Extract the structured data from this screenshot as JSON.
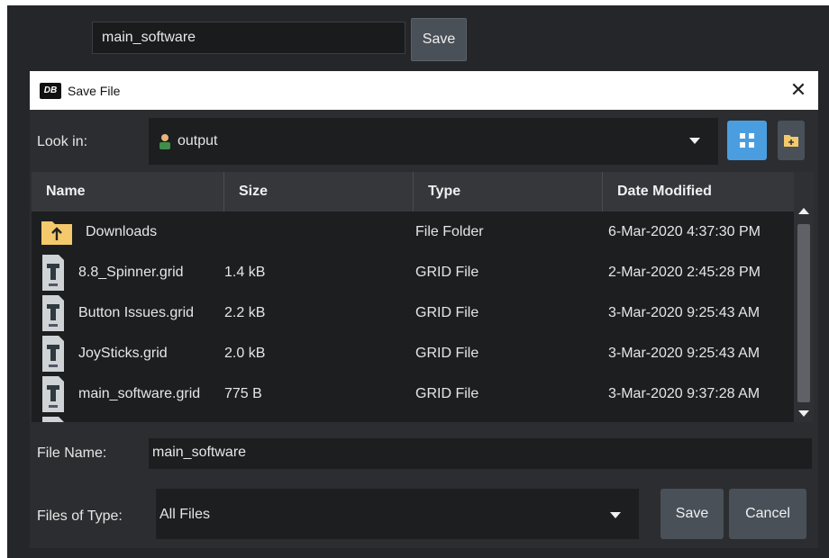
{
  "top_bar": {
    "name_value": "main_software",
    "save_label": "Save"
  },
  "dialog": {
    "app_icon_text": "DB",
    "title": "Save File",
    "close_glyph": "✕",
    "look_in_label": "Look in:",
    "look_in_value": "output",
    "columns": [
      "Name",
      "Size",
      "Type",
      "Date Modified"
    ],
    "rows": [
      {
        "icon": "folder-up-icon",
        "name": "Downloads",
        "size": "",
        "type": "File Folder",
        "date": "6-Mar-2020 4:37:30 PM"
      },
      {
        "icon": "grid-file-icon",
        "name": "8.8_Spinner.grid",
        "size": "1.4 kB",
        "type": "GRID File",
        "date": "2-Mar-2020 2:45:28 PM"
      },
      {
        "icon": "grid-file-icon",
        "name": "Button Issues.grid",
        "size": "2.2 kB",
        "type": "GRID File",
        "date": "3-Mar-2020 9:25:43 AM"
      },
      {
        "icon": "grid-file-icon",
        "name": "JoySticks.grid",
        "size": "2.0 kB",
        "type": "GRID File",
        "date": "3-Mar-2020 9:25:43 AM"
      },
      {
        "icon": "grid-file-icon",
        "name": "main_software.grid",
        "size": "775 B",
        "type": "GRID File",
        "date": "3-Mar-2020 9:37:28 AM"
      }
    ],
    "file_name_label": "File Name:",
    "file_name_value": "main_software",
    "files_of_type_label": "Files of Type:",
    "files_of_type_value": "All Files",
    "save_label": "Save",
    "cancel_label": "Cancel"
  },
  "colors": {
    "background": "#252629",
    "dialog": "#2c2d30",
    "field": "#1d1e20",
    "accent": "#4a9ee0",
    "button": "#4a5058",
    "folder": "#f3c96b"
  }
}
